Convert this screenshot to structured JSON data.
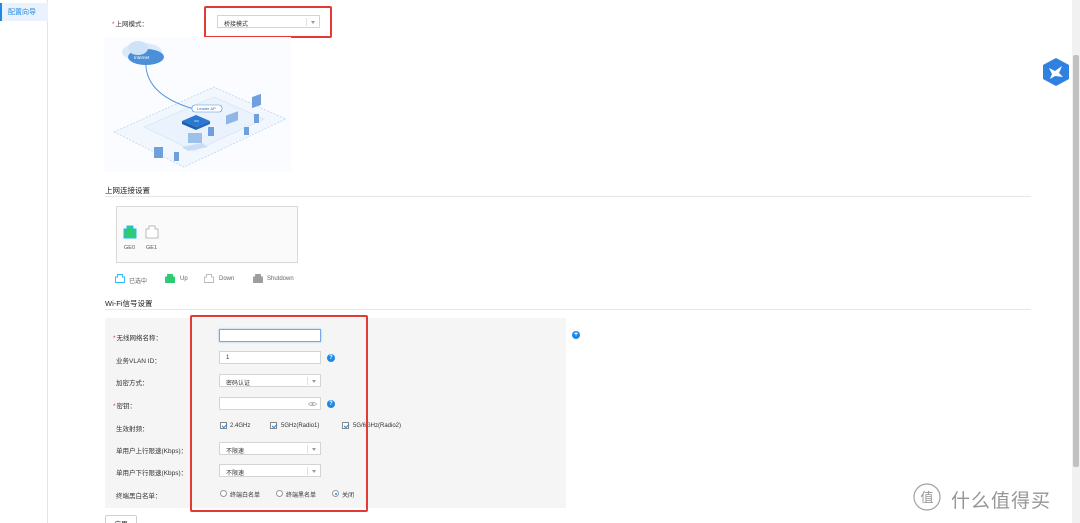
{
  "sidebar": {
    "items": [
      {
        "label": "配置向导"
      }
    ]
  },
  "mode": {
    "label": "上网模式：",
    "value": "桥接模式"
  },
  "diagram": {
    "internet_label": "Internet",
    "ap_label": "Leader AP"
  },
  "uplink": {
    "title": "上网连接设置",
    "ports": [
      {
        "label": "GE0",
        "status": "up"
      },
      {
        "label": "GE1",
        "status": "down"
      }
    ],
    "legend": [
      {
        "label": "已选中",
        "color": "#29b6f6"
      },
      {
        "label": "Up",
        "color": "#2ecc71"
      },
      {
        "label": "Down",
        "color": "#cccccc"
      },
      {
        "label": "Shutdown",
        "color": "#9e9e9e"
      }
    ]
  },
  "wifi": {
    "title": "Wi-Fi信号设置",
    "ssid_label": "无线网络名称：",
    "ssid_value": "",
    "vlan_label": "业务VLAN ID：",
    "vlan_value": "1",
    "encrypt_label": "加密方式：",
    "encrypt_value": "密码认证",
    "key_label": "密钥：",
    "key_value": "",
    "band_label": "生效射频：",
    "bands": [
      {
        "label": "2.4GHz",
        "checked": true
      },
      {
        "label": "5GHz(Radio1)",
        "checked": true
      },
      {
        "label": "5G/6GHz(Radio2)",
        "checked": true
      }
    ],
    "up_limit_label": "单用户上行限速(Kbps)：",
    "up_limit_value": "不限速",
    "down_limit_label": "单用户下行限速(Kbps)：",
    "down_limit_value": "不限速",
    "list_label": "终端黑白名单：",
    "list_options": [
      {
        "label": "终端白名单",
        "selected": false
      },
      {
        "label": "终端黑名单",
        "selected": false
      },
      {
        "label": "关闭",
        "selected": true
      }
    ]
  },
  "footer": {
    "apply_label": "应用"
  },
  "watermark": {
    "text": "什么值得买",
    "logo_text": "值"
  },
  "colors": {
    "accent": "#1e88e5",
    "highlight": "#e53935",
    "up": "#2ecc71"
  }
}
